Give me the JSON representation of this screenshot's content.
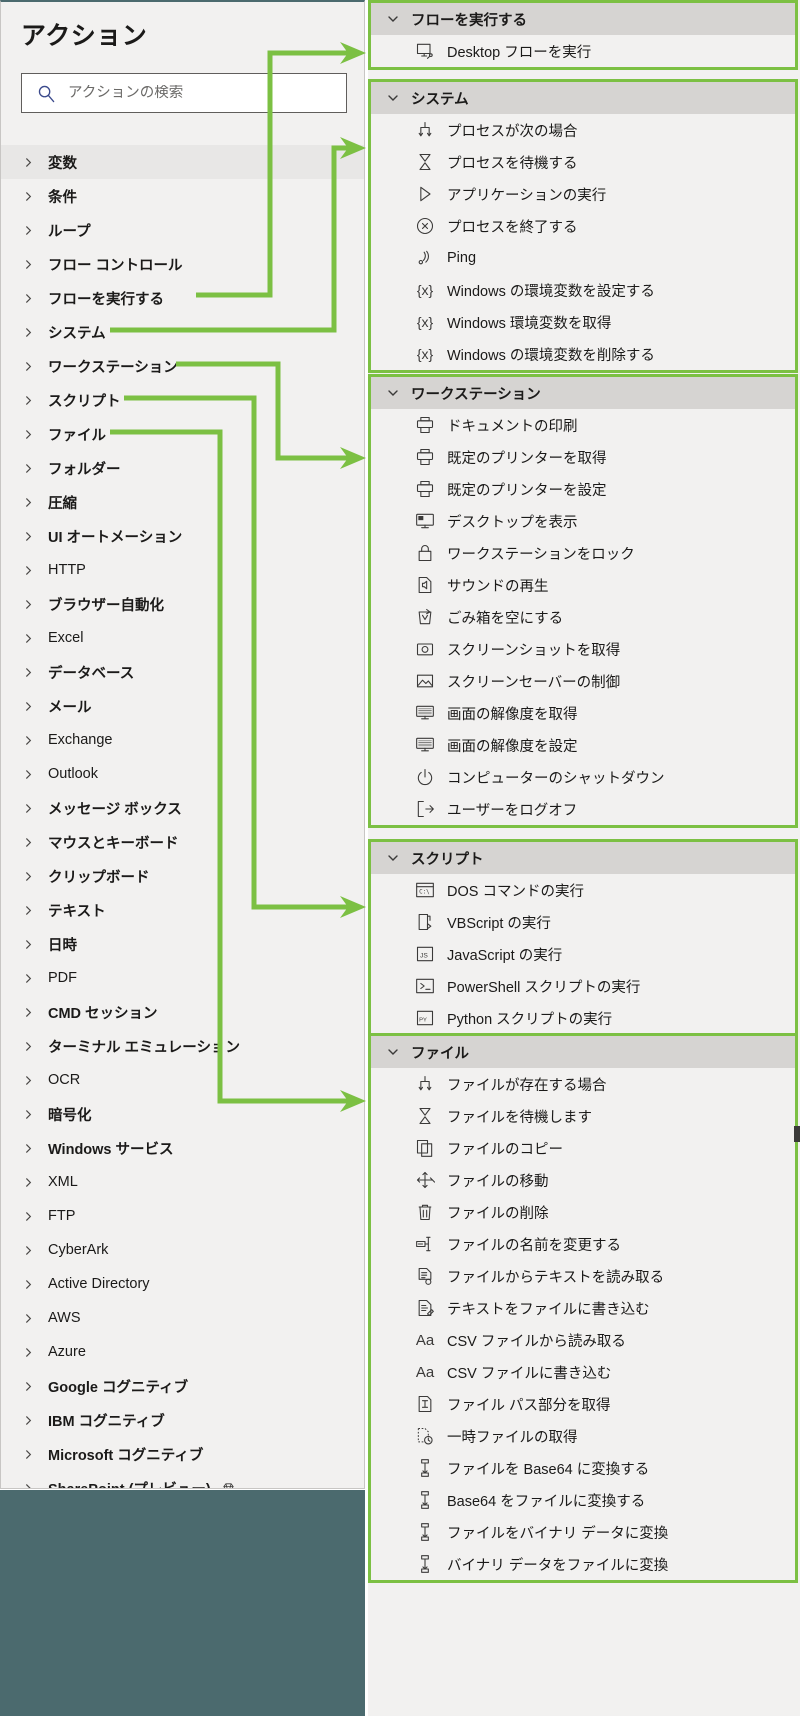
{
  "app": {
    "accent_green": "#7cc043",
    "panel_bg": "#f2f1f0",
    "header_bg": "#d6d4d2",
    "teal_bar": "#4b6a6e"
  },
  "sidebar": {
    "title": "アクション",
    "search": {
      "placeholder": "アクションの検索",
      "value": "",
      "icon": "search-icon"
    },
    "selected_index": 0,
    "items": [
      {
        "label": "変数",
        "jp": true
      },
      {
        "label": "条件",
        "jp": true
      },
      {
        "label": "ループ",
        "jp": true
      },
      {
        "label": "フロー コントロール",
        "jp": true
      },
      {
        "label": "フローを実行する",
        "jp": true
      },
      {
        "label": "システム",
        "jp": true
      },
      {
        "label": "ワークステーション",
        "jp": true
      },
      {
        "label": "スクリプト",
        "jp": true
      },
      {
        "label": "ファイル",
        "jp": true
      },
      {
        "label": "フォルダー",
        "jp": true
      },
      {
        "label": "圧縮",
        "jp": true
      },
      {
        "label": "UI オートメーション",
        "jp": true
      },
      {
        "label": "HTTP",
        "jp": false
      },
      {
        "label": "ブラウザー自動化",
        "jp": true
      },
      {
        "label": "Excel",
        "jp": false
      },
      {
        "label": "データベース",
        "jp": true
      },
      {
        "label": "メール",
        "jp": true
      },
      {
        "label": "Exchange",
        "jp": false
      },
      {
        "label": "Outlook",
        "jp": false
      },
      {
        "label": "メッセージ ボックス",
        "jp": true
      },
      {
        "label": "マウスとキーボード",
        "jp": true
      },
      {
        "label": "クリップボード",
        "jp": true
      },
      {
        "label": "テキスト",
        "jp": true
      },
      {
        "label": "日時",
        "jp": true
      },
      {
        "label": "PDF",
        "jp": false
      },
      {
        "label": "CMD セッション",
        "jp": true
      },
      {
        "label": "ターミナル エミュレーション",
        "jp": true
      },
      {
        "label": "OCR",
        "jp": false
      },
      {
        "label": "暗号化",
        "jp": true
      },
      {
        "label": "Windows サービス",
        "jp": true
      },
      {
        "label": "XML",
        "jp": false
      },
      {
        "label": "FTP",
        "jp": false
      },
      {
        "label": "CyberArk",
        "jp": false
      },
      {
        "label": "Active Directory",
        "jp": false
      },
      {
        "label": "AWS",
        "jp": false
      },
      {
        "label": "Azure",
        "jp": false
      },
      {
        "label": "Google コグニティブ",
        "jp": true
      },
      {
        "label": "IBM コグニティブ",
        "jp": true
      },
      {
        "label": "Microsoft コグニティブ",
        "jp": true
      },
      {
        "label": "SharePoint (プレビュー)",
        "jp": true,
        "badge_icon": "gem-icon"
      }
    ]
  },
  "right_panel": {
    "groups": [
      {
        "title": "フローを実行する",
        "actions": [
          {
            "label": "Desktop フローを実行",
            "icon": "run-desktop-flow-icon"
          }
        ]
      },
      {
        "title": "システム",
        "actions": [
          {
            "label": "プロセスが次の場合",
            "icon": "branch-icon"
          },
          {
            "label": "プロセスを待機する",
            "icon": "hourglass-icon"
          },
          {
            "label": "アプリケーションの実行",
            "icon": "play-icon"
          },
          {
            "label": "プロセスを終了する",
            "icon": "close-circle-icon"
          },
          {
            "label": "Ping",
            "icon": "ping-icon"
          },
          {
            "label": "Windows の環境変数を設定する",
            "icon": "variable-icon"
          },
          {
            "label": "Windows 環境変数を取得",
            "icon": "variable-icon"
          },
          {
            "label": "Windows の環境変数を削除する",
            "icon": "variable-icon"
          }
        ]
      },
      {
        "title": "ワークステーション",
        "actions": [
          {
            "label": "ドキュメントの印刷",
            "icon": "printer-icon"
          },
          {
            "label": "既定のプリンターを取得",
            "icon": "printer-icon"
          },
          {
            "label": "既定のプリンターを設定",
            "icon": "printer-icon"
          },
          {
            "label": "デスクトップを表示",
            "icon": "monitor-icon"
          },
          {
            "label": "ワークステーションをロック",
            "icon": "lock-icon"
          },
          {
            "label": "サウンドの再生",
            "icon": "sound-icon"
          },
          {
            "label": "ごみ箱を空にする",
            "icon": "recycle-bin-icon"
          },
          {
            "label": "スクリーンショットを取得",
            "icon": "camera-icon"
          },
          {
            "label": "スクリーンセーバーの制御",
            "icon": "image-icon"
          },
          {
            "label": "画面の解像度を取得",
            "icon": "display-icon"
          },
          {
            "label": "画面の解像度を設定",
            "icon": "display-icon"
          },
          {
            "label": "コンピューターのシャットダウン",
            "icon": "power-icon"
          },
          {
            "label": "ユーザーをログオフ",
            "icon": "logoff-icon"
          }
        ]
      },
      {
        "title": "スクリプト",
        "actions": [
          {
            "label": "DOS コマンドの実行",
            "icon": "cmd-icon"
          },
          {
            "label": "VBScript の実行",
            "icon": "vbscript-icon"
          },
          {
            "label": "JavaScript の実行",
            "icon": "js-icon"
          },
          {
            "label": "PowerShell スクリプトの実行",
            "icon": "powershell-icon"
          },
          {
            "label": "Python スクリプトの実行",
            "icon": "python-icon"
          }
        ]
      },
      {
        "title": "ファイル",
        "actions": [
          {
            "label": "ファイルが存在する場合",
            "icon": "branch-icon"
          },
          {
            "label": "ファイルを待機します",
            "icon": "hourglass-icon"
          },
          {
            "label": "ファイルのコピー",
            "icon": "copy-icon"
          },
          {
            "label": "ファイルの移動",
            "icon": "move-icon"
          },
          {
            "label": "ファイルの削除",
            "icon": "trash-icon"
          },
          {
            "label": "ファイルの名前を変更する",
            "icon": "rename-icon"
          },
          {
            "label": "ファイルからテキストを読み取る",
            "icon": "read-text-icon"
          },
          {
            "label": "テキストをファイルに書き込む",
            "icon": "write-text-icon"
          },
          {
            "label": "CSV ファイルから読み取る",
            "icon": "text-aa-icon"
          },
          {
            "label": "CSV ファイルに書き込む",
            "icon": "text-aa-icon"
          },
          {
            "label": "ファイル パス部分を取得",
            "icon": "file-path-icon"
          },
          {
            "label": "一時ファイルの取得",
            "icon": "temp-file-icon"
          },
          {
            "label": "ファイルを Base64 に変換する",
            "icon": "convert-icon"
          },
          {
            "label": "Base64 をファイルに変換する",
            "icon": "convert-icon"
          },
          {
            "label": "ファイルをバイナリ データに変換",
            "icon": "convert-icon"
          },
          {
            "label": "バイナリ データをファイルに変換",
            "icon": "convert-icon"
          }
        ]
      }
    ]
  },
  "connectors": {
    "color": "#7cc043",
    "links": [
      {
        "from": "フローを実行する",
        "to": "フローを実行する"
      },
      {
        "from": "システム",
        "to": "システム"
      },
      {
        "from": "ワークステーション",
        "to": "ワークステーション"
      },
      {
        "from": "スクリプト",
        "to": "スクリプト"
      },
      {
        "from": "ファイル",
        "to": "ファイル"
      }
    ]
  }
}
